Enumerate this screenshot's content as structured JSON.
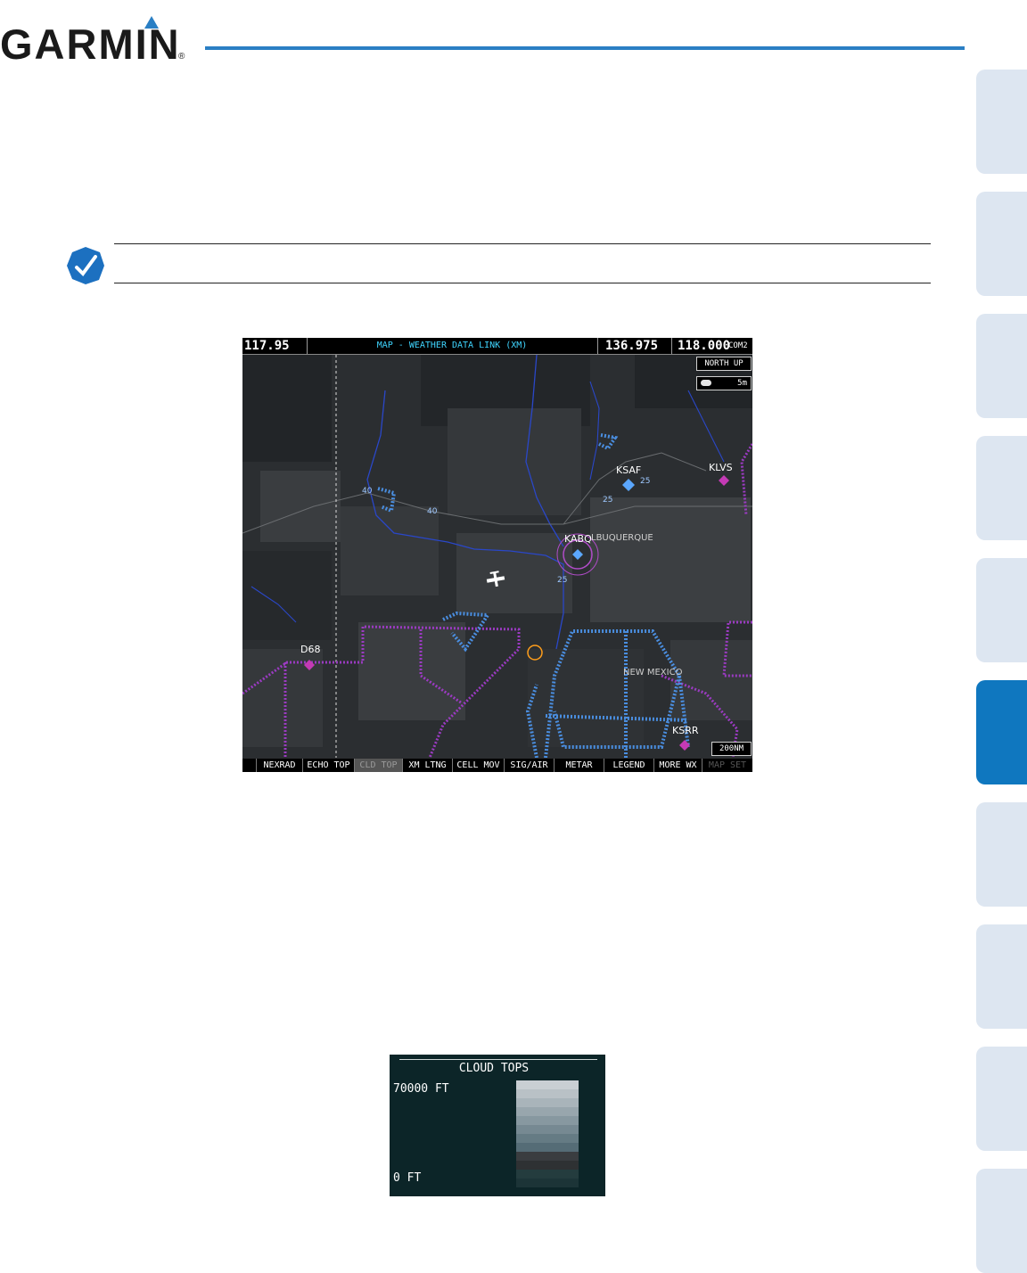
{
  "header": {
    "brand": "GARMIN",
    "registered": "®",
    "accent_color": "#2a7fc4"
  },
  "side_tabs": {
    "count": 10,
    "active_index": 5,
    "tab_color": "#dde6f1",
    "active_color": "#0f77bf"
  },
  "note": {
    "icon": "note-pencil-icon"
  },
  "mfd": {
    "nav_freq": "117.95",
    "page_title": "MAP - WEATHER DATA LINK (XM)",
    "com_standby": "136.975",
    "com_active": "118.000",
    "com_label": "COM2",
    "orientation": "NORTH UP",
    "data_age": "5m",
    "data_age_icon": "cloud-data-icon",
    "range": "200NM",
    "airports": {
      "ksaf": "KSAF",
      "klvs": "KLVS",
      "kabq": "KABQ",
      "d68": "D68",
      "ksrr": "KSRR"
    },
    "place_labels": {
      "albuquerque": "LBUQUERQUE",
      "new_mexico": "NEW MEXICO"
    },
    "highway_shields": [
      "40",
      "40",
      "25",
      "25",
      "25"
    ],
    "softkeys": [
      "",
      "NEXRAD",
      "ECHO TOP",
      "CLD TOP",
      "XM LTNG",
      "CELL MOV",
      "SIG/AIR",
      "METAR",
      "LEGEND",
      "MORE WX",
      "MAP SET"
    ],
    "active_softkey": "CLD TOP"
  },
  "legend": {
    "title": "CLOUD TOPS",
    "top_label": "70000 FT",
    "bottom_label": "0 FT",
    "scale_colors": [
      "#c9cfd3",
      "#b9c1c6",
      "#a9b4ba",
      "#98a6ad",
      "#8798a0",
      "#768992",
      "#657b84",
      "#556c76",
      "#3a3d40",
      "#2e3133",
      "#243c3e",
      "#1c3437"
    ]
  }
}
